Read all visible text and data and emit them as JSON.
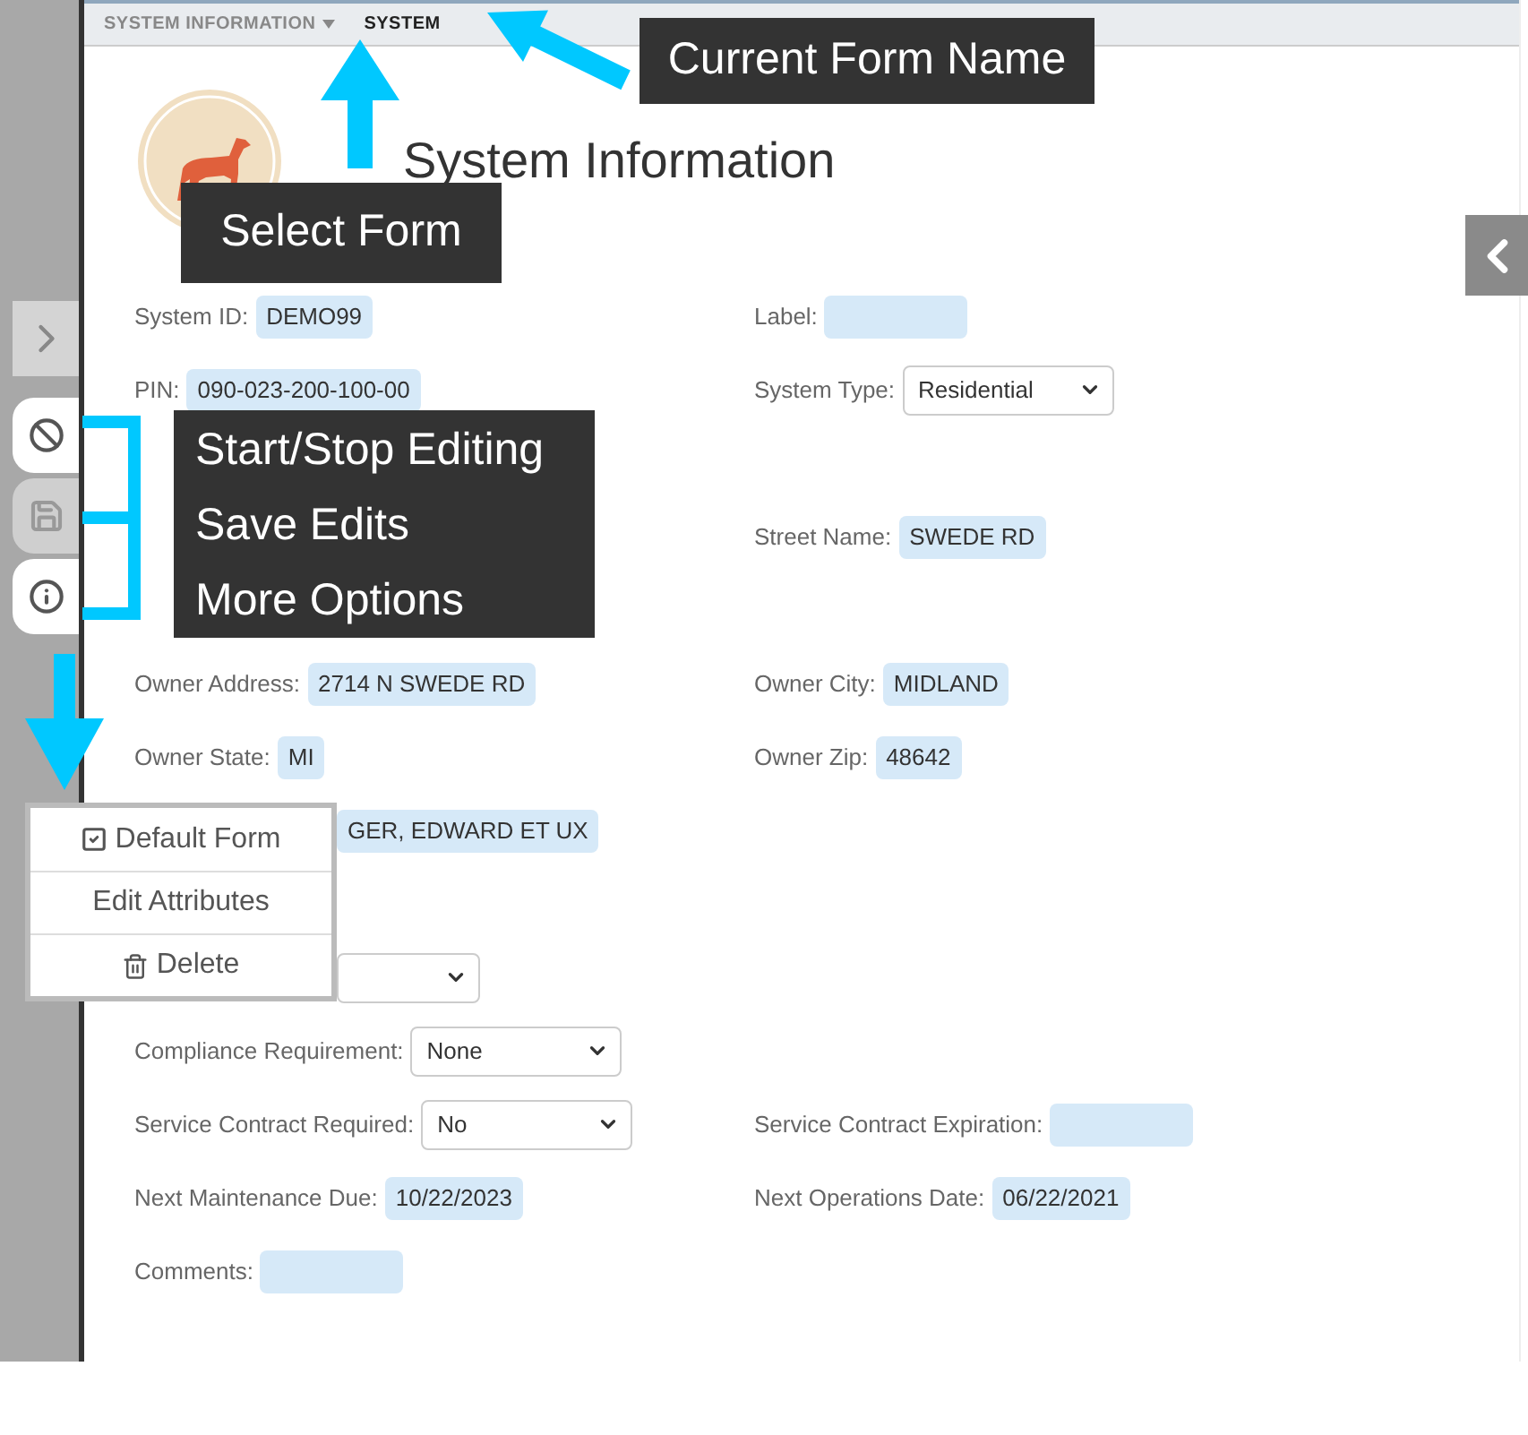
{
  "breadcrumb": [
    {
      "label": "SYSTEM INFORMATION",
      "dropdown": true,
      "current": false
    },
    {
      "label": "SYSTEM",
      "dropdown": false,
      "current": true
    }
  ],
  "title": "System Information",
  "tools": [
    {
      "kind": "edit",
      "disabled": false
    },
    {
      "kind": "save",
      "disabled": true
    },
    {
      "kind": "info",
      "disabled": false
    }
  ],
  "form_rows": [
    {
      "left": {
        "kind": "text",
        "label": "System ID:",
        "value": "DEMO99"
      },
      "right": {
        "kind": "text",
        "label": "Label:"
      }
    },
    {
      "left": {
        "kind": "text",
        "label": "PIN:",
        "value": "090-023-200-100-00"
      },
      "right": {
        "kind": "select",
        "label": "System Type:",
        "value": "Residential"
      }
    },
    {},
    {
      "right": {
        "kind": "text",
        "label": "Street Name:",
        "value": "SWEDE RD"
      }
    },
    {},
    {
      "left": {
        "kind": "text",
        "label": "Owner Address:",
        "value": "2714 N SWEDE RD"
      },
      "right": {
        "kind": "text",
        "label": "Owner City:",
        "value": "MIDLAND"
      }
    },
    {
      "left": {
        "kind": "text",
        "label": "Owner State:",
        "value": "MI"
      },
      "right": {
        "kind": "text",
        "label": "Owner Zip:",
        "value": "48642"
      }
    },
    {
      "left": {
        "kind": "covered_text",
        "value": "GER, EDWARD ET UX"
      }
    },
    {},
    {
      "left": {
        "kind": "covered_select"
      }
    },
    {
      "left": {
        "kind": "select",
        "label": "Compliance Requirement:",
        "value": "None"
      }
    },
    {
      "left": {
        "kind": "select",
        "label": "Service Contract Required:",
        "value": "No"
      },
      "right": {
        "kind": "text",
        "label": "Service Contract Expiration:"
      }
    },
    {
      "left": {
        "kind": "text",
        "label": "Next Maintenance Due:",
        "value": "10/22/2023"
      },
      "right": {
        "kind": "text",
        "label": "Next Operations Date:",
        "value": "06/22/2021"
      }
    },
    {
      "left": {
        "kind": "text",
        "label": "Comments:"
      }
    }
  ],
  "menu": [
    {
      "kind": "check",
      "label": "Default Form",
      "checked": true
    },
    {
      "kind": "plain",
      "label": "Edit Attributes"
    },
    {
      "kind": "delete",
      "label": "Delete"
    }
  ],
  "callouts": {
    "current_form": "Current Form Name",
    "select_form": "Select Form",
    "tools": [
      "Start/Stop Editing",
      "Save Edits",
      "More Options"
    ]
  }
}
